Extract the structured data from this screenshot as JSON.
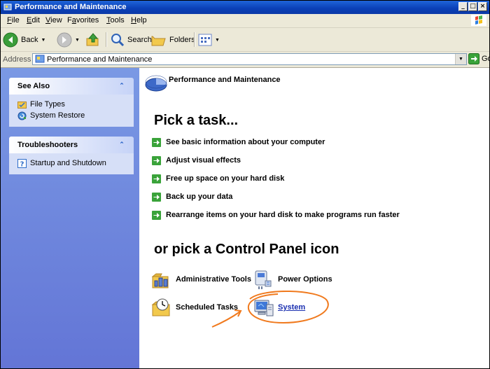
{
  "window": {
    "title": "Performance and Maintenance"
  },
  "menubar": {
    "items": [
      "File",
      "Edit",
      "View",
      "Favorites",
      "Tools",
      "Help"
    ],
    "accel": [
      "F",
      "E",
      "V",
      "a",
      "T",
      "H"
    ]
  },
  "toolbar": {
    "back": "Back",
    "search": "Search",
    "folders": "Folders"
  },
  "address": {
    "label": "Address",
    "value": "Performance and Maintenance",
    "go": "Go"
  },
  "see_also": {
    "title": "See Also",
    "items": [
      "File Types",
      "System Restore"
    ]
  },
  "troubleshooters": {
    "title": "Troubleshooters",
    "items": [
      "Startup and Shutdown"
    ]
  },
  "content": {
    "category": "Performance and Maintenance",
    "pick_task": "Pick a task...",
    "tasks": [
      "See basic information about your computer",
      "Adjust visual effects",
      "Free up space on your hard disk",
      "Back up your data",
      "Rearrange items on your hard disk to make programs run faster"
    ],
    "pick_icon": "or pick a Control Panel icon",
    "icons": [
      "Administrative Tools",
      "Power Options",
      "Scheduled Tasks",
      "System"
    ]
  },
  "colors": {
    "accent": "#0a3fb6",
    "annotation": "#f07a1e",
    "link": "#1a2fb0"
  }
}
